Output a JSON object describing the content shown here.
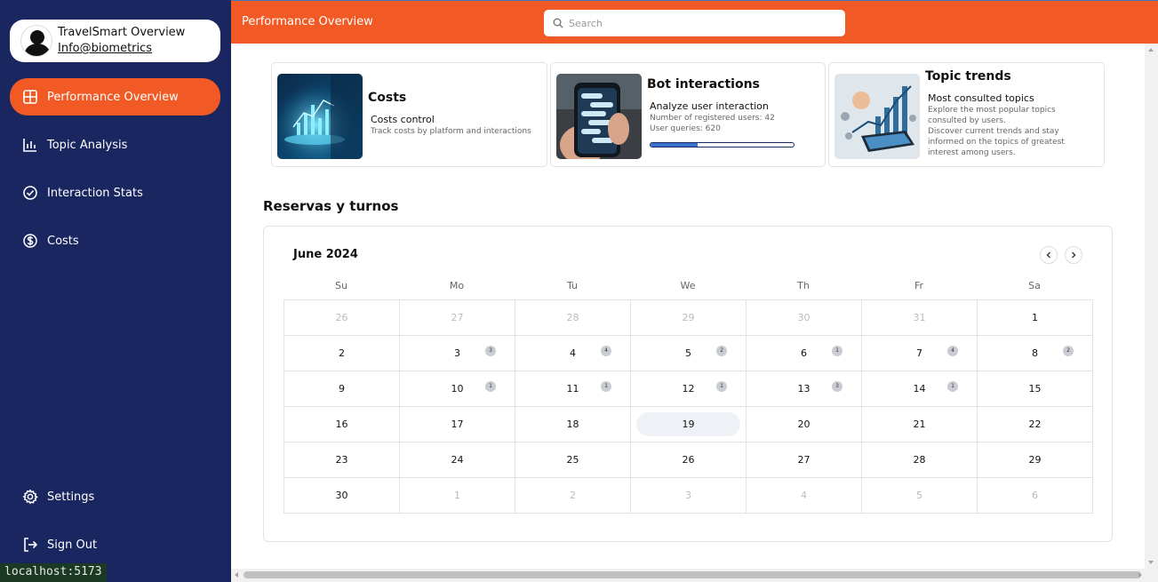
{
  "app": {
    "profile": {
      "name": "TravelSmart Overview",
      "email": "Info@biometrics"
    },
    "nav": [
      {
        "label": "Performance Overview",
        "icon": "grid-icon",
        "active": true
      },
      {
        "label": "Topic Analysis",
        "icon": "bar-chart-icon",
        "active": false
      },
      {
        "label": "Interaction Stats",
        "icon": "check-circle-icon",
        "active": false
      },
      {
        "label": "Costs",
        "icon": "dollar-circle-icon",
        "active": false
      }
    ],
    "footer_nav": [
      {
        "label": "Settings",
        "icon": "gear-icon"
      },
      {
        "label": "Sign Out",
        "icon": "sign-out-icon"
      }
    ],
    "status_url": "localhost:5173",
    "colors": {
      "accent": "#f15a24",
      "sidebar": "#1a2660",
      "progress": "#3b6fd0"
    }
  },
  "header": {
    "title": "Performance Overview",
    "search_placeholder": "Search"
  },
  "cards": [
    {
      "title": "Costs",
      "subtitle": "Costs control",
      "description": "Track costs by platform and interactions",
      "image": "costs-image"
    },
    {
      "title": "Bot interactions",
      "subtitle": "Analyze user interaction",
      "registered_users": "Number of registered users: 42",
      "queries": "User queries: 620",
      "progress": 0.33,
      "image": "bot-phone-image"
    },
    {
      "title": "Topic trends",
      "subtitle": "Most consulted topics",
      "description": "Explore the most popular topics consulted by users.",
      "description2": "Discover current trends and stay informed on the topics of greatest interest among users.",
      "image": "trends-image"
    }
  ],
  "section": {
    "title": "Reservas y turnos"
  },
  "calendar": {
    "month": "June 2024",
    "weekdays": [
      "Su",
      "Mo",
      "Tu",
      "We",
      "Th",
      "Fr",
      "Sa"
    ],
    "weeks": [
      [
        {
          "d": "26",
          "muted": true
        },
        {
          "d": "27",
          "muted": true
        },
        {
          "d": "28",
          "muted": true
        },
        {
          "d": "29",
          "muted": true
        },
        {
          "d": "30",
          "muted": true
        },
        {
          "d": "31",
          "muted": true
        },
        {
          "d": "1"
        }
      ],
      [
        {
          "d": "2"
        },
        {
          "d": "3",
          "badge": "3"
        },
        {
          "d": "4",
          "badge": "4"
        },
        {
          "d": "5",
          "badge": "2"
        },
        {
          "d": "6",
          "badge": "1"
        },
        {
          "d": "7",
          "badge": "4"
        },
        {
          "d": "8",
          "badge": "2"
        }
      ],
      [
        {
          "d": "9"
        },
        {
          "d": "10",
          "badge": "1"
        },
        {
          "d": "11",
          "badge": "1"
        },
        {
          "d": "12",
          "badge": "1"
        },
        {
          "d": "13",
          "badge": "3"
        },
        {
          "d": "14",
          "badge": "1"
        },
        {
          "d": "15"
        }
      ],
      [
        {
          "d": "16"
        },
        {
          "d": "17"
        },
        {
          "d": "18"
        },
        {
          "d": "19",
          "today": true
        },
        {
          "d": "20"
        },
        {
          "d": "21"
        },
        {
          "d": "22"
        }
      ],
      [
        {
          "d": "23"
        },
        {
          "d": "24"
        },
        {
          "d": "25"
        },
        {
          "d": "26"
        },
        {
          "d": "27"
        },
        {
          "d": "28"
        },
        {
          "d": "29"
        }
      ],
      [
        {
          "d": "30"
        },
        {
          "d": "1",
          "muted": true
        },
        {
          "d": "2",
          "muted": true
        },
        {
          "d": "3",
          "muted": true
        },
        {
          "d": "4",
          "muted": true
        },
        {
          "d": "5",
          "muted": true
        },
        {
          "d": "6",
          "muted": true
        }
      ]
    ]
  }
}
